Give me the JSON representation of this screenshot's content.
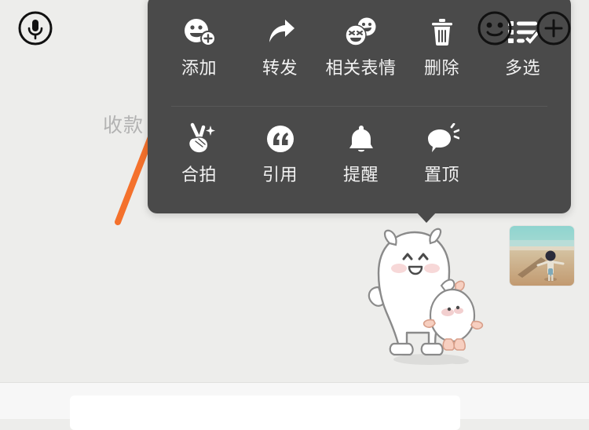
{
  "app": {
    "surface_color": "#ededeb",
    "panel_color": "#4a4a4a",
    "accent_color": "#f4712c"
  },
  "chat": {
    "receipt_label": "收款",
    "sticker_alt": "white-bear-and-chick-sticker",
    "photo_alt": "beach-child-photo"
  },
  "annotation": {
    "arrow_color": "#f4712c",
    "arrow_name": "orange-pointer-arrow"
  },
  "context_menu": {
    "rows": [
      {
        "items": [
          {
            "icon": "smiley-plus-icon",
            "label": "添加"
          },
          {
            "icon": "forward-arrow-icon",
            "label": "转发"
          },
          {
            "icon": "double-smiley-icon",
            "label": "相关表情"
          },
          {
            "icon": "trash-icon",
            "label": "删除"
          },
          {
            "icon": "list-check-icon",
            "label": "多选"
          }
        ]
      },
      {
        "items": [
          {
            "icon": "victory-hand-sparkle-icon",
            "label": "合拍"
          },
          {
            "icon": "quote-mark-icon",
            "label": "引用"
          },
          {
            "icon": "bell-icon",
            "label": "提醒"
          },
          {
            "icon": "speech-bubble-pin-icon",
            "label": "置顶"
          }
        ]
      }
    ]
  },
  "input_bar": {
    "voice_icon": "voice-record-icon",
    "text_value": "",
    "text_placeholder": "",
    "emoji_icon": "emoji-face-icon",
    "more_icon": "plus-circle-icon"
  }
}
